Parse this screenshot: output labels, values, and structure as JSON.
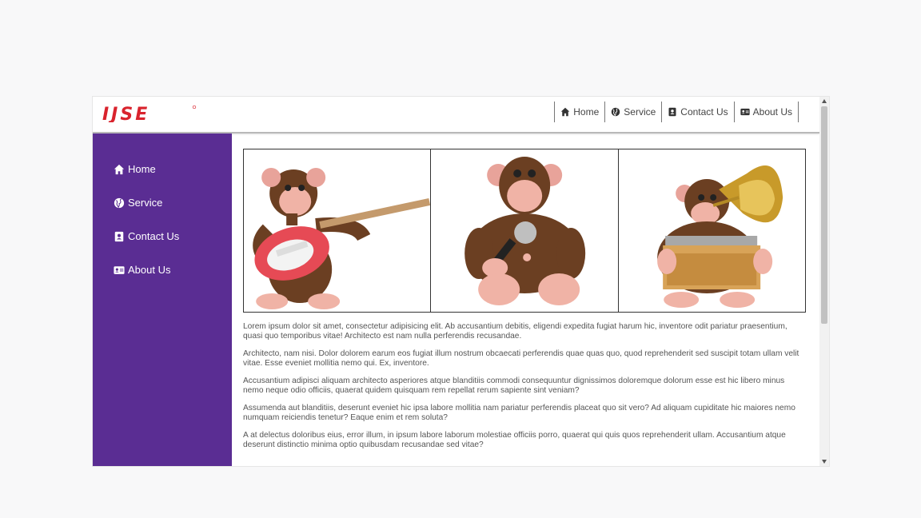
{
  "brand": {
    "logo_text": "IJSE",
    "accent_color": "#d9232d"
  },
  "topnav": {
    "items": [
      {
        "label": "Home",
        "icon": "home-icon"
      },
      {
        "label": "Service",
        "icon": "globe-icon"
      },
      {
        "label": "Contact Us",
        "icon": "contact-card-icon"
      },
      {
        "label": "About Us",
        "icon": "id-card-icon"
      }
    ]
  },
  "sidebar": {
    "color": "#5a2d93",
    "items": [
      {
        "label": "Home",
        "icon": "home-icon"
      },
      {
        "label": "Service",
        "icon": "globe-icon"
      },
      {
        "label": "Contact Us",
        "icon": "contact-card-icon"
      },
      {
        "label": "About Us",
        "icon": "id-card-icon"
      }
    ]
  },
  "gallery": {
    "images": [
      "monkey-guitar-image",
      "monkey-microphone-image",
      "monkey-gramophone-image"
    ]
  },
  "paragraphs": [
    "Lorem ipsum dolor sit amet, consectetur adipisicing elit. Ab accusantium debitis, eligendi expedita fugiat harum hic, inventore odit pariatur praesentium, quasi quo temporibus vitae! Architecto est nam nulla perferendis recusandae.",
    "Architecto, nam nisi. Dolor dolorem earum eos fugiat illum nostrum obcaecati perferendis quae quas quo, quod reprehenderit sed suscipit totam ullam velit vitae. Esse eveniet mollitia nemo qui. Ex, inventore.",
    "Accusantium adipisci aliquam architecto asperiores atque blanditiis commodi consequuntur dignissimos doloremque dolorum esse est hic libero minus nemo neque odio officiis, quaerat quidem quisquam rem repellat rerum sapiente sint veniam?",
    "Assumenda aut blanditiis, deserunt eveniet hic ipsa labore mollitia nam pariatur perferendis placeat quo sit vero? Ad aliquam cupiditate hic maiores nemo numquam reiciendis tenetur? Eaque enim et rem soluta?",
    "A at delectus doloribus eius, error illum, in ipsum labore laborum molestiae officiis porro, quaerat qui quis quos reprehenderit ullam. Accusantium atque deserunt distinctio minima optio quibusdam recusandae sed vitae?"
  ]
}
